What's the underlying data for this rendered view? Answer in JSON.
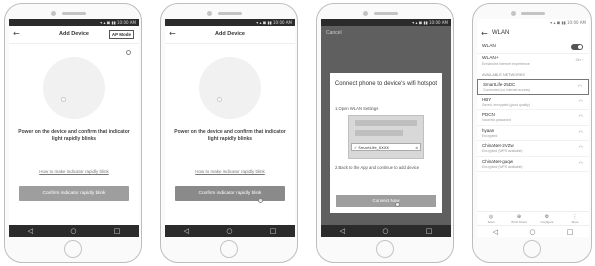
{
  "status_bar": {
    "text": "▾ ▴ ◼ ▮▮ 10:00 AM"
  },
  "navbar": {
    "back": "◁",
    "home": "○",
    "recent": "□"
  },
  "screen1": {
    "title": "Add Device",
    "ap_mode_label": "AP Mode",
    "instruction": "Power on the device and confirm that indicator light rapidly blinks",
    "help_link": "How to make indicator rapidly blink",
    "confirm_button": "Confirm indicator rapidly blink"
  },
  "screen2": {
    "title": "Add Device",
    "instruction": "Power on the device and confirm that indicator light rapidly blinks",
    "help_link": "How to make indicator rapidly blink",
    "confirm_button": "Confirm indicator rapidly blink"
  },
  "screen3": {
    "cancel": "Cancel",
    "modal_title": "Connect phone to device's wifi hotspot",
    "step1": "1.Open WLAN Settings",
    "network_example": "✓ SmartLife_XXXX",
    "step2": "2.Back to the App and continue to add device",
    "connect_button": "Connect Now"
  },
  "screen4": {
    "header": "WLAN",
    "wlan_label": "WLAN",
    "wlanplus_label": "WLAN+",
    "wlanplus_sub": "Enhanced internet experience",
    "wlanplus_state": "On",
    "section": "AVAILABLE NETWORKS",
    "networks": [
      {
        "name": "SmartLife-25DC",
        "status": "Connected (no internet access)"
      },
      {
        "name": "HBY",
        "status": "Saved, encrypted (good quality)"
      },
      {
        "name": "PDCN",
        "status": "Incorrect password"
      },
      {
        "name": "hyaan",
        "status": "Encrypted"
      },
      {
        "name": "ChinaNet-2VZw",
        "status": "Encrypted (WPS available)"
      },
      {
        "name": "ChinaNet-guqw",
        "status": "Encrypted (WPS available)"
      }
    ],
    "actions": [
      {
        "icon": "◎",
        "label": "Scan"
      },
      {
        "icon": "⊕",
        "label": "Wi-Fi Direct"
      },
      {
        "icon": "⚙",
        "label": "Configure"
      },
      {
        "icon": "⋮",
        "label": "More"
      }
    ]
  }
}
